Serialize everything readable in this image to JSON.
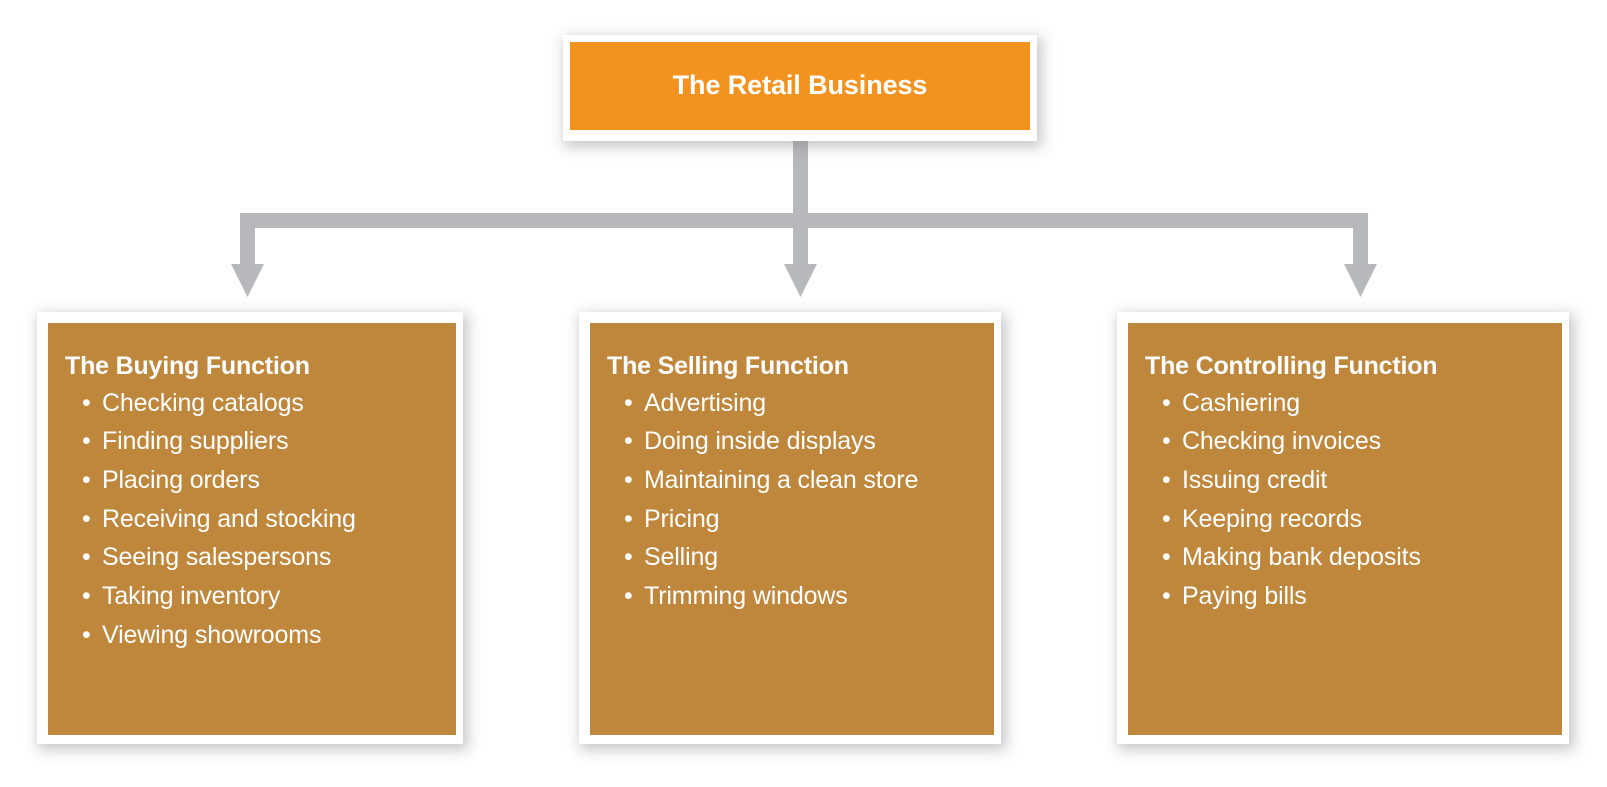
{
  "diagram": {
    "title": "The Retail Business",
    "colors": {
      "root_fill": "#F3931F",
      "node_fill": "#BF873C",
      "connector": "#B7B8BC",
      "frame": "#FFFFFF",
      "text": "#FFFFFF",
      "background": "#FFFFFF"
    },
    "root": {
      "label": "The Retail Business"
    },
    "branches": [
      {
        "id": "buying",
        "title": "The Buying Function",
        "bullet": "•",
        "items": [
          "Checking catalogs",
          "Finding suppliers",
          "Placing orders",
          "Receiving and stocking",
          "Seeing salespersons",
          "Taking inventory",
          "Viewing showrooms"
        ]
      },
      {
        "id": "selling",
        "title": "The Selling Function",
        "bullet": "•",
        "items": [
          "Advertising",
          "Doing inside displays",
          "Maintaining a clean store",
          "Pricing",
          "Selling",
          "Trimming windows"
        ]
      },
      {
        "id": "controlling",
        "title": "The Controlling Function",
        "bullet": "•",
        "items": [
          "Cashiering",
          "Checking invoices",
          "Issuing credit",
          "Keeping records",
          "Making bank deposits",
          "Paying bills"
        ]
      }
    ]
  }
}
